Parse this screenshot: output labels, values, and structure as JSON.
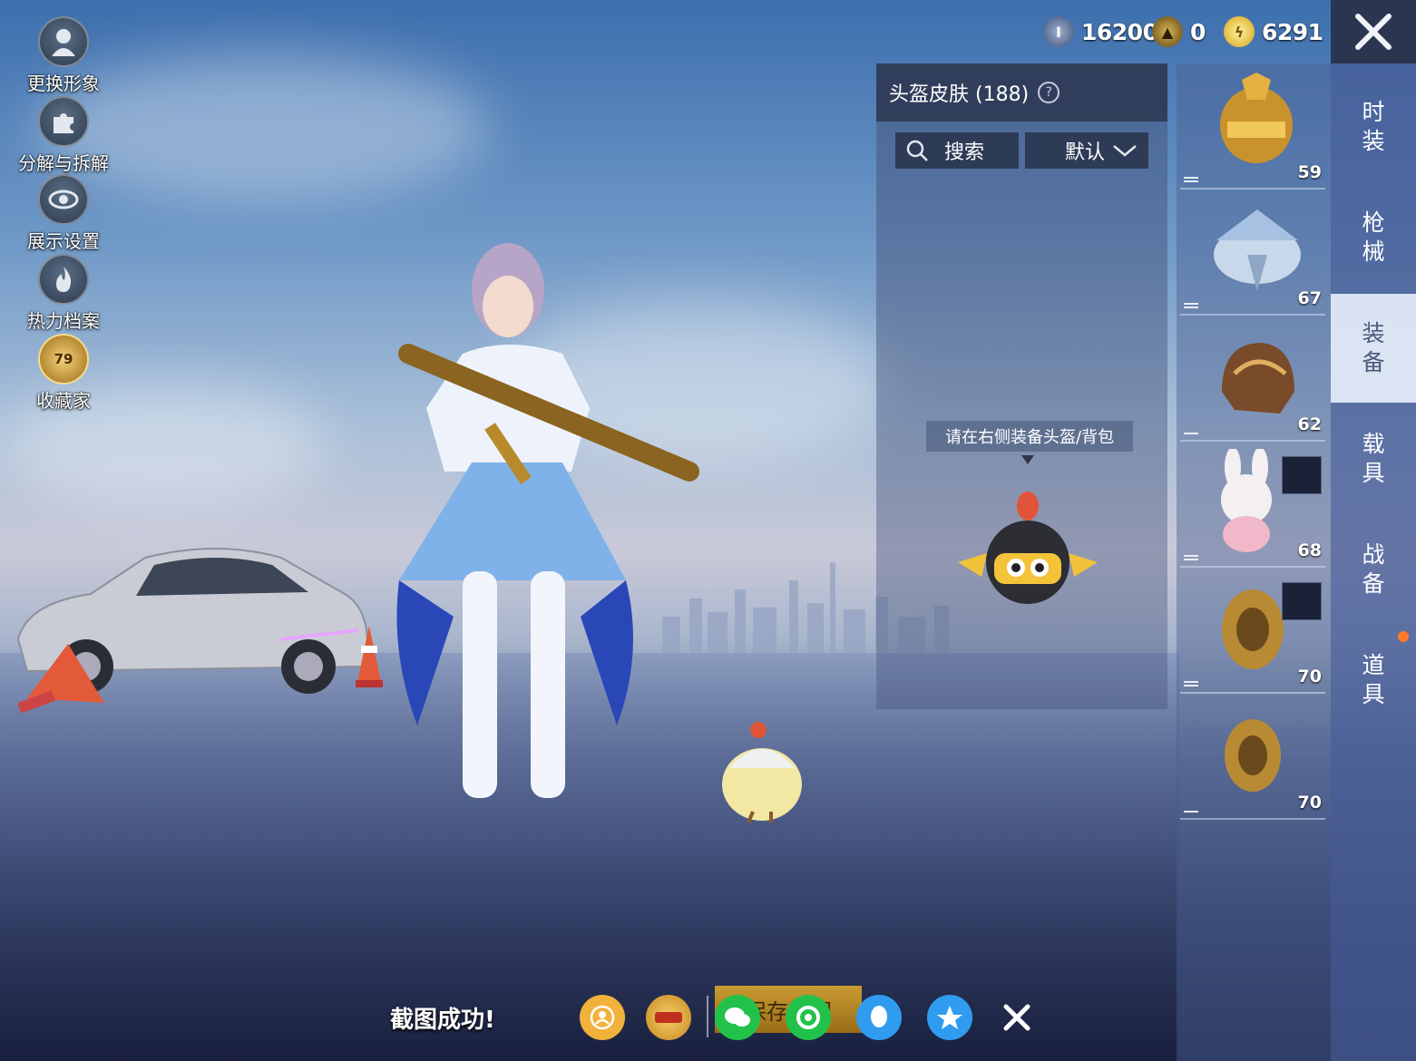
{
  "left_menu": [
    {
      "label": "更换形象",
      "icon": "person-icon"
    },
    {
      "label": "分解与拆解",
      "icon": "puzzle-icon"
    },
    {
      "label": "展示设置",
      "icon": "eye-icon"
    },
    {
      "label": "热力档案",
      "icon": "flame-icon"
    },
    {
      "label": "收藏家",
      "icon": "collector-badge-icon",
      "badge_level": "79"
    }
  ],
  "currency": {
    "points": "16200",
    "tokens": "0",
    "coins": "6291"
  },
  "panel": {
    "title": "头盔皮肤 (188)",
    "search_label": "搜索",
    "sort_label": "默认",
    "hint": "请在右侧装备头盔/背包"
  },
  "items": [
    {
      "level": "59",
      "name": "gold-helmet"
    },
    {
      "level": "67",
      "name": "silver-wing-helmet"
    },
    {
      "level": "62",
      "name": "bronze-helmet"
    },
    {
      "level": "68",
      "name": "rabbit-backpack"
    },
    {
      "level": "70",
      "name": "gold-ring-helmet"
    },
    {
      "level": "70",
      "name": "gold-ring-helmet-2"
    }
  ],
  "tabs": [
    "时装",
    "枪械",
    "装备",
    "载具",
    "战备",
    "道具"
  ],
  "active_tab": "装备",
  "bottom": {
    "toast": "截图成功!",
    "save_label": "保存截图",
    "share_targets": [
      "friend",
      "game-elite",
      "wechat",
      "moments",
      "qq",
      "qzone",
      "close"
    ]
  },
  "colors": {
    "panel_bg": "#2d3750",
    "tab_active": "#e6eefa",
    "accent_dot": "#ff7a2a",
    "gold": "#c99a32"
  }
}
